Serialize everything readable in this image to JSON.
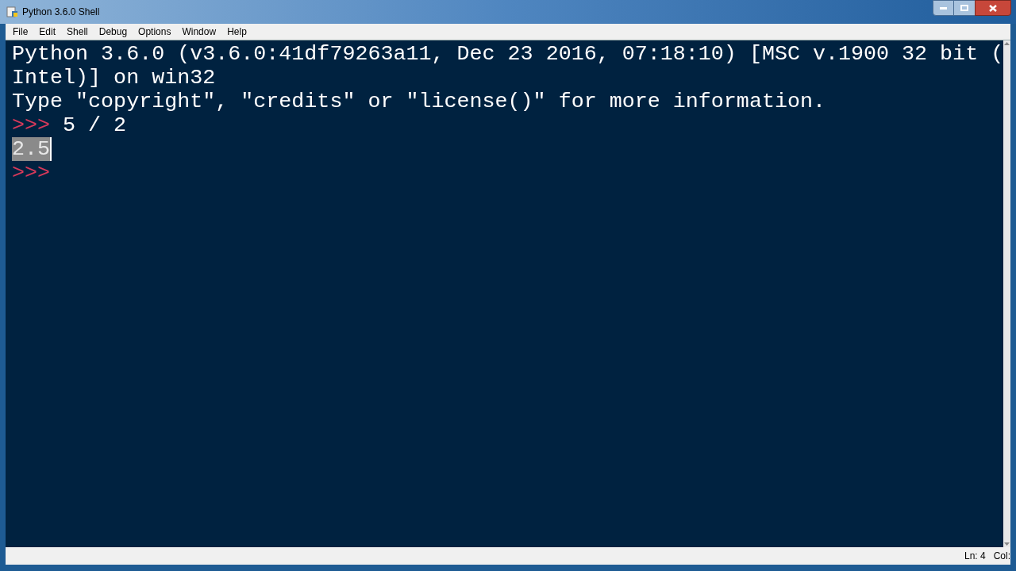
{
  "window": {
    "title": "Python 3.6.0 Shell"
  },
  "menu": [
    "File",
    "Edit",
    "Shell",
    "Debug",
    "Options",
    "Window",
    "Help"
  ],
  "lines": [
    {
      "kind": "output",
      "text": "Python 3.6.0 (v3.6.0:41df79263a11, Dec 23 2016, 07:18:10) [MSC v.1900 32 bit (",
      "selected": false
    },
    {
      "kind": "output",
      "text": "Intel)] on win32",
      "selected": false
    },
    {
      "kind": "output",
      "text": "Type \"copyright\", \"credits\" or \"license()\" for more information.",
      "selected": false
    },
    {
      "kind": "prompt",
      "prompt": ">>>",
      "text": "5 / 2"
    },
    {
      "kind": "output",
      "text": "2.5",
      "selected": true
    },
    {
      "kind": "prompt",
      "prompt": ">>>"
    }
  ],
  "status_bar": {
    "line": "Ln: 4",
    "column": "Col:"
  }
}
